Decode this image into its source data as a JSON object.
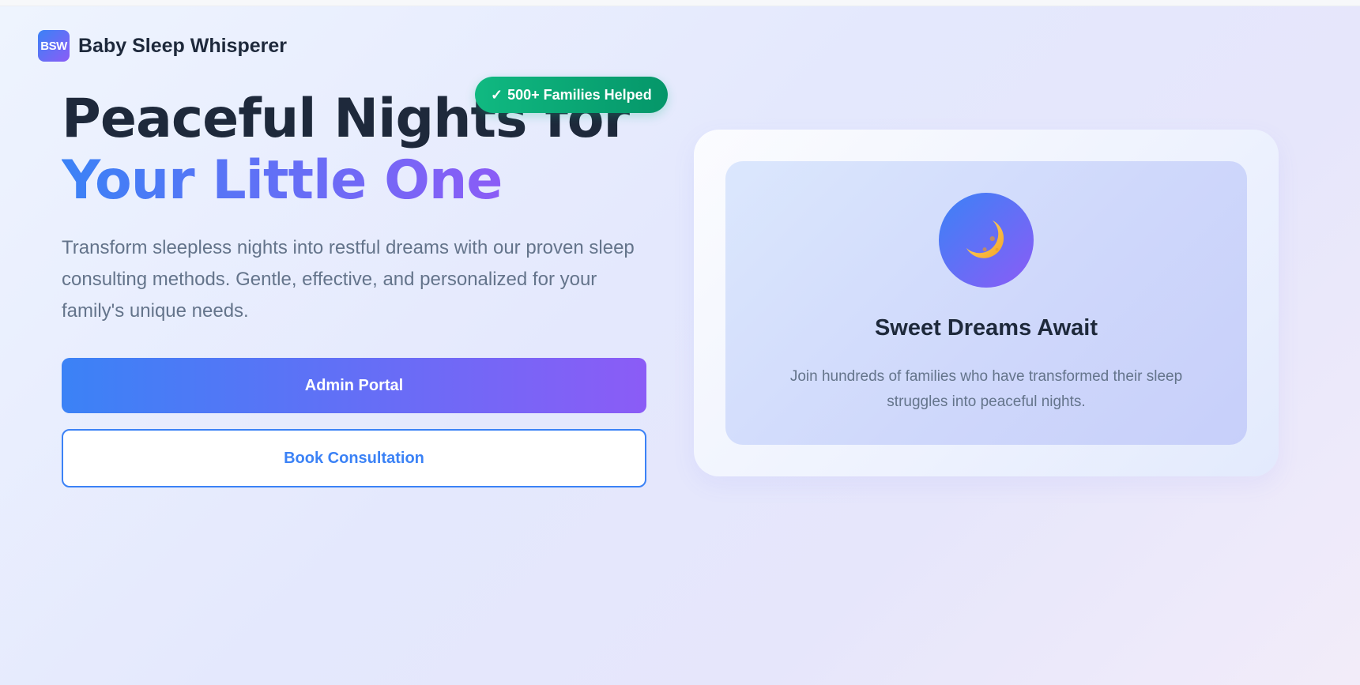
{
  "header": {
    "logo_text": "BSW",
    "brand_name": "Baby Sleep Whisperer"
  },
  "hero": {
    "title_line1": "Peaceful Nights for",
    "title_line2": "Your Little One",
    "badge_check": "✓",
    "badge_text": "500+ Families Helped",
    "description": "Transform sleepless nights into restful dreams with our proven sleep consulting methods. Gentle, effective, and personalized for your family's unique needs.",
    "primary_button": "Admin Portal",
    "secondary_button": "Book Consultation"
  },
  "card": {
    "icon": "moon-icon",
    "title": "Sweet Dreams Await",
    "text": "Join hundreds of families who have transformed their sleep struggles into peaceful nights."
  },
  "colors": {
    "accent_blue": "#3b82f6",
    "accent_purple": "#8b5cf6",
    "badge_green": "#10b981",
    "heading": "#1e293b",
    "body_text": "#64748b"
  }
}
